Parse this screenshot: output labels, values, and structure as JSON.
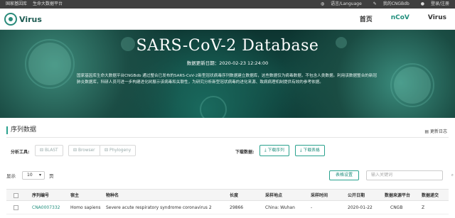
{
  "topbar": {
    "left": [
      "国家基因库",
      "生命大数据平台"
    ],
    "right": [
      "语言/Language",
      "我的CNGBdb",
      "登录/注册"
    ]
  },
  "nav": {
    "logo_text": "Virus",
    "items": [
      "首页",
      "nCoV",
      "Virus"
    ],
    "active": "nCoV"
  },
  "hero": {
    "title": "SARS-CoV-2 Database",
    "date": "数据更新日期：2020-02-23 12:24:00",
    "description": "国家基因库生命大数据平台CNGBdb 通过整合已发布的SARS-CoV-2新型冠状病毒序列数据建立数据库，这些数据仅为病毒数据，不包含人类数据。利用该数据整合的新冠肺炎数据库，科研人员可进一步构建进化树展示该病毒和关联性，为研究分析新型冠状病毒的进化来源、致病病理机制提供有效的参考依据。"
  },
  "section": {
    "title": "序列数据",
    "update_log": "更新日志"
  },
  "tools": {
    "analysis_label": "分析工具:",
    "analysis_buttons": [
      "BLAST",
      "Browser",
      "Phylogeny"
    ],
    "download_label": "下载数据:",
    "download_buttons": [
      "下载序列",
      "下载表格"
    ]
  },
  "listing": {
    "show_label": "显示",
    "page_size": "10",
    "unit_label": "页",
    "column_settings": "表格设置",
    "search_placeholder": "输入关键词"
  },
  "table": {
    "headers": [
      "序列编号",
      "宿主",
      "物种名",
      "长度",
      "采样地点",
      "采样时间",
      "公开日期",
      "数据来源平台",
      "数据递交"
    ],
    "rows": [
      [
        "CNA0007332",
        "Homo sapiens",
        "Severe acute respiratory syndrome coronavirus 2",
        "29866",
        "China: Wuhan",
        "-",
        "2020-01-22",
        "CNGB",
        "Z"
      ]
    ]
  },
  "colors": {
    "accent": "#1f8e7c",
    "topbar": "#3f3f3f",
    "hero_dark": "#0d3430"
  }
}
